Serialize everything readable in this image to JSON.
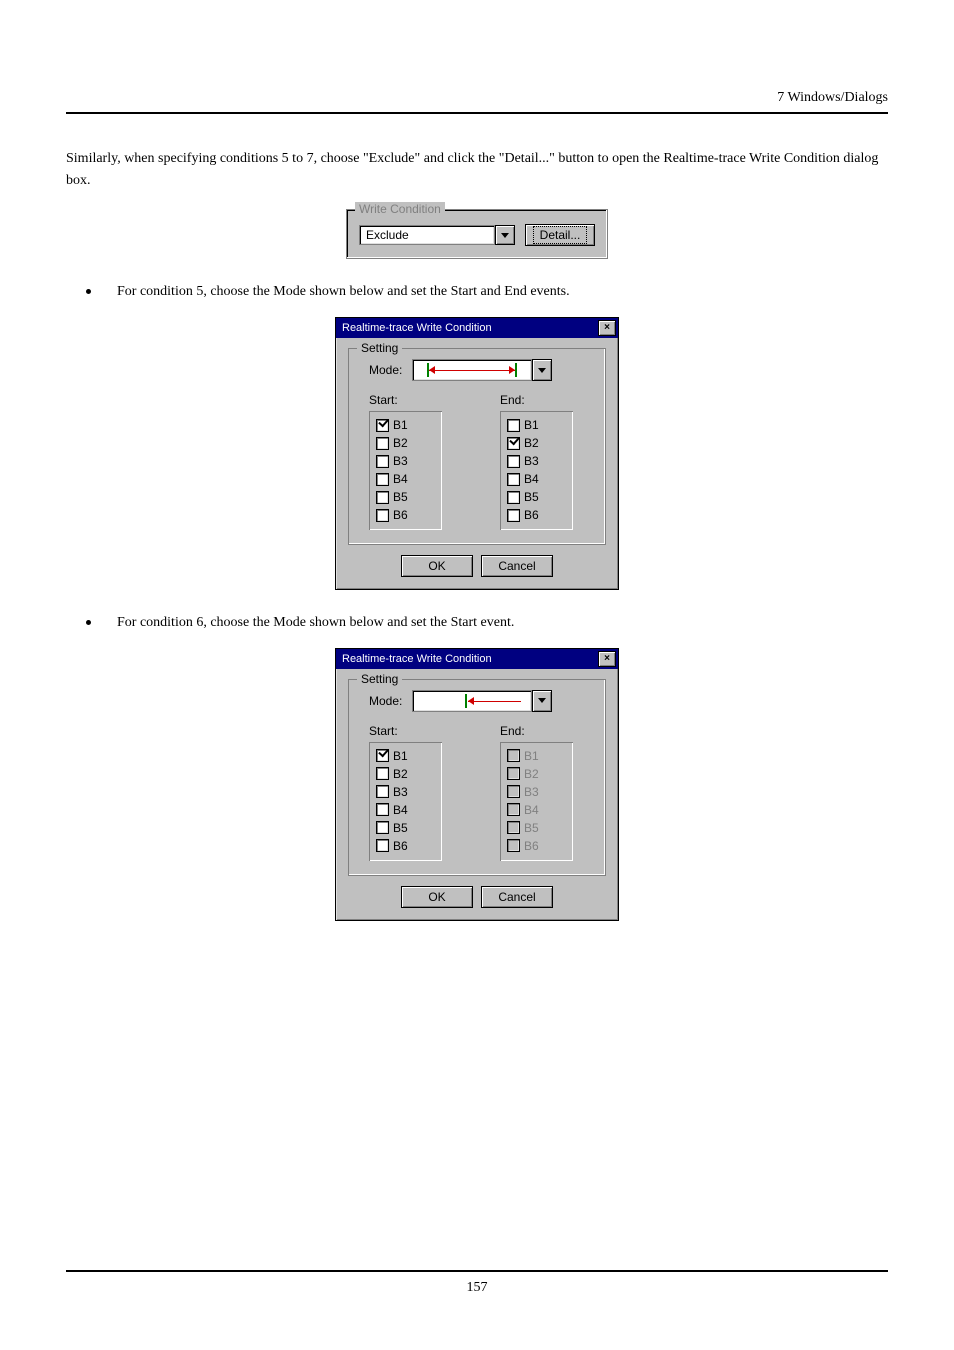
{
  "header": {
    "section": "7  Windows/Dialogs"
  },
  "intro": {
    "text": "Similarly, when specifying conditions 5 to 7, choose \"Exclude\" and click the \"Detail...\" button to open the Realtime-trace Write Condition dialog box."
  },
  "writeCondition": {
    "legend": "Write Condition",
    "option": "Exclude",
    "detailBtn": "Detail..."
  },
  "bulletA": {
    "text": "For condition 5, choose the Mode shown below and set the Start and End events."
  },
  "bulletB": {
    "text": "For condition 6, choose the Mode shown below and set the Start event."
  },
  "dialog": {
    "title": "Realtime-trace Write Condition",
    "settingLegend": "Setting",
    "modeLabel": "Mode:",
    "startLabel": "Start:",
    "endLabel": "End:",
    "options": [
      "B1",
      "B2",
      "B3",
      "B4",
      "B5",
      "B6"
    ],
    "okBtn": "OK",
    "cancelBtn": "Cancel"
  },
  "dlgA": {
    "modeKind": "between",
    "start": {
      "B1": true,
      "B2": false,
      "B3": false,
      "B4": false,
      "B5": false,
      "B6": false
    },
    "end": {
      "B1": false,
      "B2": true,
      "B3": false,
      "B4": false,
      "B5": false,
      "B6": false
    },
    "endDisabled": false
  },
  "dlgB": {
    "modeKind": "fromstart",
    "start": {
      "B1": true,
      "B2": false,
      "B3": false,
      "B4": false,
      "B5": false,
      "B6": false
    },
    "end": {
      "B1": false,
      "B2": false,
      "B3": false,
      "B4": false,
      "B5": false,
      "B6": false
    },
    "endDisabled": true
  },
  "pageNumber": "157"
}
